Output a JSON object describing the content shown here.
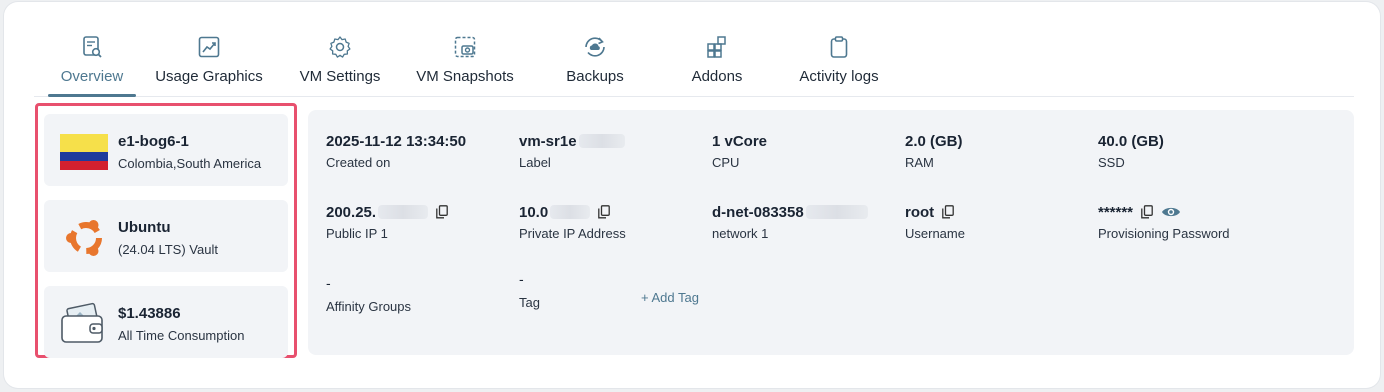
{
  "tabs": [
    {
      "label": "Overview",
      "icon": "document-search-icon",
      "active": true
    },
    {
      "label": "Usage Graphics",
      "icon": "chart-trend-icon",
      "active": false
    },
    {
      "label": "VM Settings",
      "icon": "gear-icon",
      "active": false
    },
    {
      "label": "VM Snapshots",
      "icon": "camera-snapshot-icon",
      "active": false
    },
    {
      "label": "Backups",
      "icon": "cloud-sync-icon",
      "active": false
    },
    {
      "label": "Addons",
      "icon": "grid-plus-icon",
      "active": false
    },
    {
      "label": "Activity logs",
      "icon": "clipboard-icon",
      "active": false
    }
  ],
  "summary": {
    "location": {
      "name": "e1-bog6-1",
      "region": "Colombia,South America",
      "icon": "colombia-flag-icon"
    },
    "os": {
      "name": "Ubuntu",
      "version": "(24.04 LTS) Vault",
      "icon": "ubuntu-logo-icon"
    },
    "billing": {
      "amount": "$1.43886",
      "label": "All Time Consumption",
      "icon": "wallet-icon"
    }
  },
  "details": {
    "created_on": {
      "value": "2025-11-12 13:34:50",
      "label": "Created on"
    },
    "vm_label": {
      "value": "vm-sr1e",
      "label": "Label"
    },
    "cpu": {
      "value": "1 vCore",
      "label": "CPU"
    },
    "ram": {
      "value": "2.0 (GB)",
      "label": "RAM"
    },
    "ssd": {
      "value": "40.0 (GB)",
      "label": "SSD"
    },
    "public_ip": {
      "value": "200.25.",
      "label": "Public IP 1"
    },
    "private_ip": {
      "value": "10.0",
      "label": "Private IP Address"
    },
    "network": {
      "value": "d-net-083358",
      "label": "network 1"
    },
    "username": {
      "value": "root",
      "label": "Username"
    },
    "password": {
      "value": "******",
      "label": "Provisioning Password"
    },
    "affinity": {
      "value": "-",
      "label": "Affinity Groups"
    },
    "tag": {
      "value": "-",
      "label": "Tag"
    },
    "add_tag_label": "+ Add Tag"
  },
  "colors": {
    "accent": "#4e7890",
    "highlight_border": "#e8506e",
    "panel_bg": "#f2f4f7"
  }
}
